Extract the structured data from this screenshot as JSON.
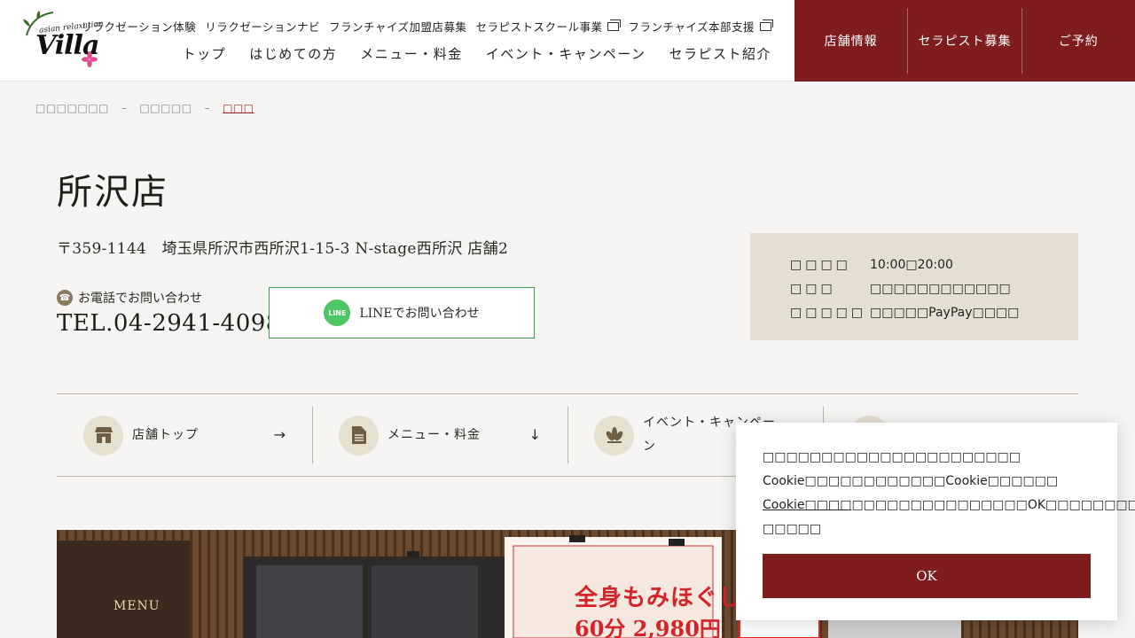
{
  "header": {
    "logo_sub": "asian relaxation",
    "logo_main": "Villa",
    "top_links": [
      {
        "label": "リラクゼーション体験",
        "external": false
      },
      {
        "label": "リラクゼーションナビ",
        "external": false
      },
      {
        "label": "フランチャイズ加盟店募集",
        "external": false
      },
      {
        "label": "セラピストスクール事業",
        "external": true
      },
      {
        "label": "フランチャイズ本部支援",
        "external": true
      }
    ],
    "main_nav": [
      "トップ",
      "はじめての方",
      "メニュー・料金",
      "イベント・キャンペーン",
      "セラピスト紹介"
    ],
    "cta": [
      "店舗情報",
      "セラピスト募集",
      "ご予約"
    ]
  },
  "breadcrumb": [
    "□□□□□□□",
    "□□□□□",
    "□□□"
  ],
  "store": {
    "title": "所沢店",
    "address": "〒359-1144　埼玉県所沢市西所沢1-15-3 N-stage西所沢 店舗2",
    "tel_label": "お電話でお問い合わせ",
    "tel": "TEL.04-2941-4098",
    "line_button": "LINEでお問い合わせ",
    "line_icon_text": "LINE",
    "info": [
      {
        "k": "□□□□",
        "v": "10:00□20:00"
      },
      {
        "k": "□□□",
        "v": "□□□□□□□□□□□□"
      },
      {
        "k": "□□□□□",
        "v": "□□□□□PayPay□□□□"
      }
    ]
  },
  "tabs": [
    {
      "label": "店舗トップ",
      "icon": "shop-icon",
      "arrow": "→"
    },
    {
      "label": "メニュー・料金",
      "icon": "document-icon",
      "arrow": "↓"
    },
    {
      "label": "イベント・キャンペーン",
      "icon": "flower-icon",
      "arrow": "→"
    },
    {
      "label": "",
      "icon": "heart-icon",
      "arrow": "→"
    }
  ],
  "photo": {
    "sign_menu": "MENU",
    "sign_main": "全身もみほぐし",
    "sign_price": "60分 2,980円"
  },
  "cookie": {
    "line1": "□□□□□□□□□□□□□□□□□□□□□□",
    "line2": "Cookie□□□□□□□□□□□□Cookie□□□□□□",
    "link": "Cookie□□□□",
    "line3": "□□□□□□□□□□□□□□□OK□□□□□□□□□",
    "line4": "□□□□□",
    "ok": "OK"
  },
  "colors": {
    "brand": "#7e1c1e",
    "line_green": "#4cc764",
    "info_bg": "#e4dfd1"
  }
}
